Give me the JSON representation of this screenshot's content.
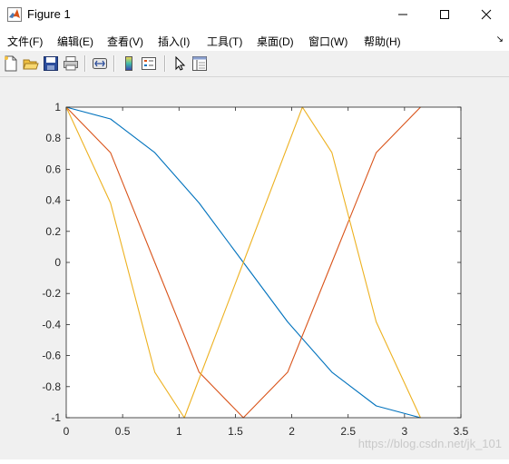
{
  "window": {
    "title": "Figure 1"
  },
  "menu": {
    "items": [
      {
        "label": "文件(F)"
      },
      {
        "label": "编辑(E)"
      },
      {
        "label": "查看(V)"
      },
      {
        "label": "插入(I)"
      },
      {
        "label": "工具(T)"
      },
      {
        "label": "桌面(D)"
      },
      {
        "label": "窗口(W)"
      },
      {
        "label": "帮助(H)"
      }
    ]
  },
  "toolbar": {
    "buttons": [
      "new-figure-icon",
      "open-file-icon",
      "save-icon",
      "print-icon",
      "link-icon",
      "colorbar-icon",
      "legend-icon",
      "select-arrow-icon",
      "property-inspector-icon"
    ]
  },
  "watermark": "https://blog.csdn.net/jk_101",
  "chart_data": {
    "type": "line",
    "xlim": [
      0,
      3.5
    ],
    "ylim": [
      -1,
      1
    ],
    "xticks": [
      "0",
      "0.5",
      "1",
      "1.5",
      "2",
      "2.5",
      "3",
      "3.5"
    ],
    "yticks": [
      "-1",
      "-0.8",
      "-0.6",
      "-0.4",
      "-0.2",
      "0",
      "0.2",
      "0.4",
      "0.6",
      "0.8",
      "1"
    ],
    "grid": false,
    "series": [
      {
        "color": "#0072bd",
        "x": [
          0,
          0.3927,
          0.7854,
          1.1781,
          1.5708,
          1.9635,
          2.3562,
          2.7489,
          3.1416
        ],
        "y": [
          1,
          0.924,
          0.707,
          0.383,
          0,
          -0.383,
          -0.707,
          -0.924,
          -1
        ]
      },
      {
        "color": "#d95319",
        "x": [
          0,
          0.3927,
          0.7854,
          1.1781,
          1.5708,
          1.9635,
          2.3562,
          2.7489,
          3.1416
        ],
        "y": [
          1,
          0.707,
          0,
          -0.707,
          -1,
          -0.707,
          0,
          0.707,
          1
        ]
      },
      {
        "color": "#edb120",
        "x": [
          0,
          0.3927,
          0.7854,
          1.0472,
          1.5708,
          2.0944,
          2.3562,
          2.7489,
          3.1416
        ],
        "y": [
          1,
          0.383,
          -0.707,
          -1,
          0,
          1,
          0.707,
          -0.383,
          -1
        ]
      }
    ]
  }
}
